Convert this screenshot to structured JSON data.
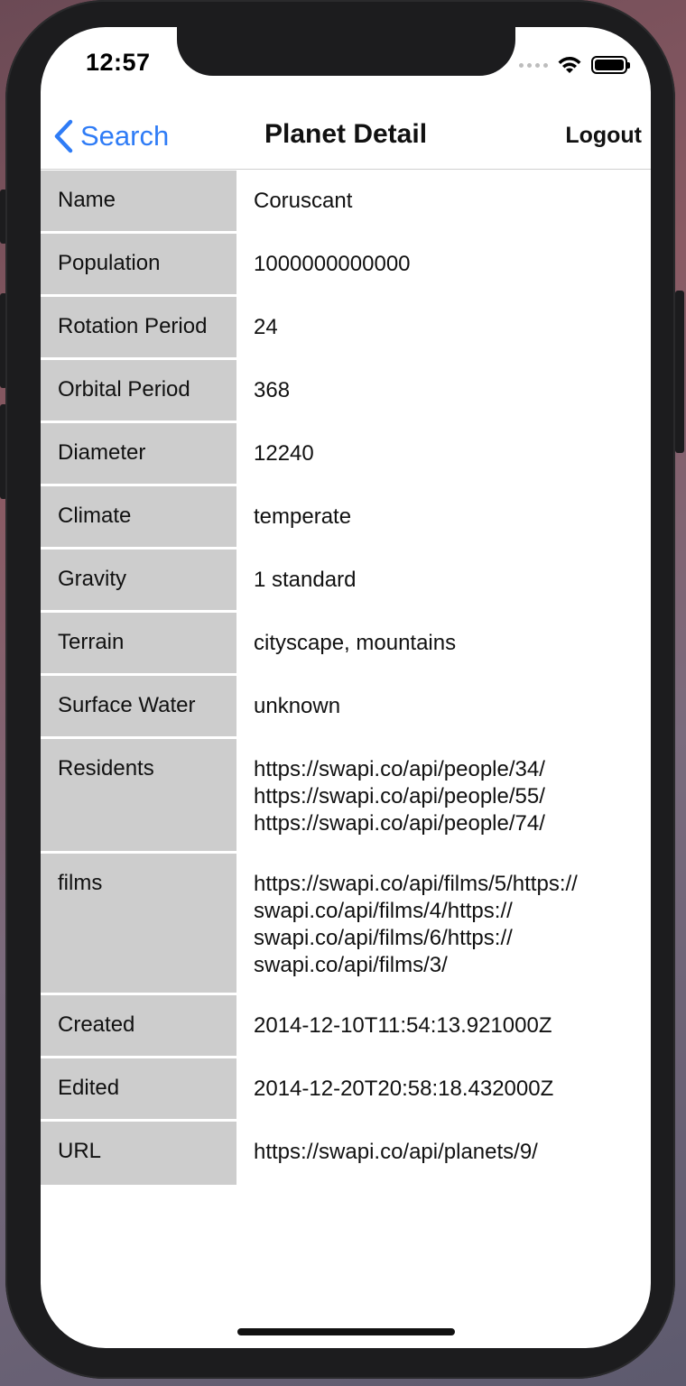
{
  "status": {
    "time": "12:57"
  },
  "nav": {
    "back_label": "Search",
    "title": "Planet Detail",
    "logout_label": "Logout"
  },
  "rows": [
    {
      "label": "Name",
      "value": "Coruscant"
    },
    {
      "label": "Population",
      "value": "1000000000000"
    },
    {
      "label": "Rotation Period",
      "value": "24"
    },
    {
      "label": "Orbital Period",
      "value": "368"
    },
    {
      "label": "Diameter",
      "value": "12240"
    },
    {
      "label": "Climate",
      "value": "temperate"
    },
    {
      "label": "Gravity",
      "value": "1 standard"
    },
    {
      "label": "Terrain",
      "value": "cityscape, mountains"
    },
    {
      "label": "Surface Water",
      "value": "unknown"
    },
    {
      "label": "Residents",
      "value_lines": [
        "https://swapi.co/api/people/34/",
        "https://swapi.co/api/people/55/",
        "https://swapi.co/api/people/74/"
      ]
    },
    {
      "label": "films",
      "value_lines": [
        "https://swapi.co/api/films/5/https://",
        "swapi.co/api/films/4/https://",
        "swapi.co/api/films/6/https://",
        "swapi.co/api/films/3/"
      ]
    },
    {
      "label": "Created",
      "value": "2014-12-10T11:54:13.921000Z"
    },
    {
      "label": "Edited",
      "value": "2014-12-20T20:58:18.432000Z"
    },
    {
      "label": "URL",
      "value": "https://swapi.co/api/planets/9/"
    }
  ],
  "colors": {
    "accent": "#2f7cf6",
    "label_bg": "#cdcdcd"
  }
}
